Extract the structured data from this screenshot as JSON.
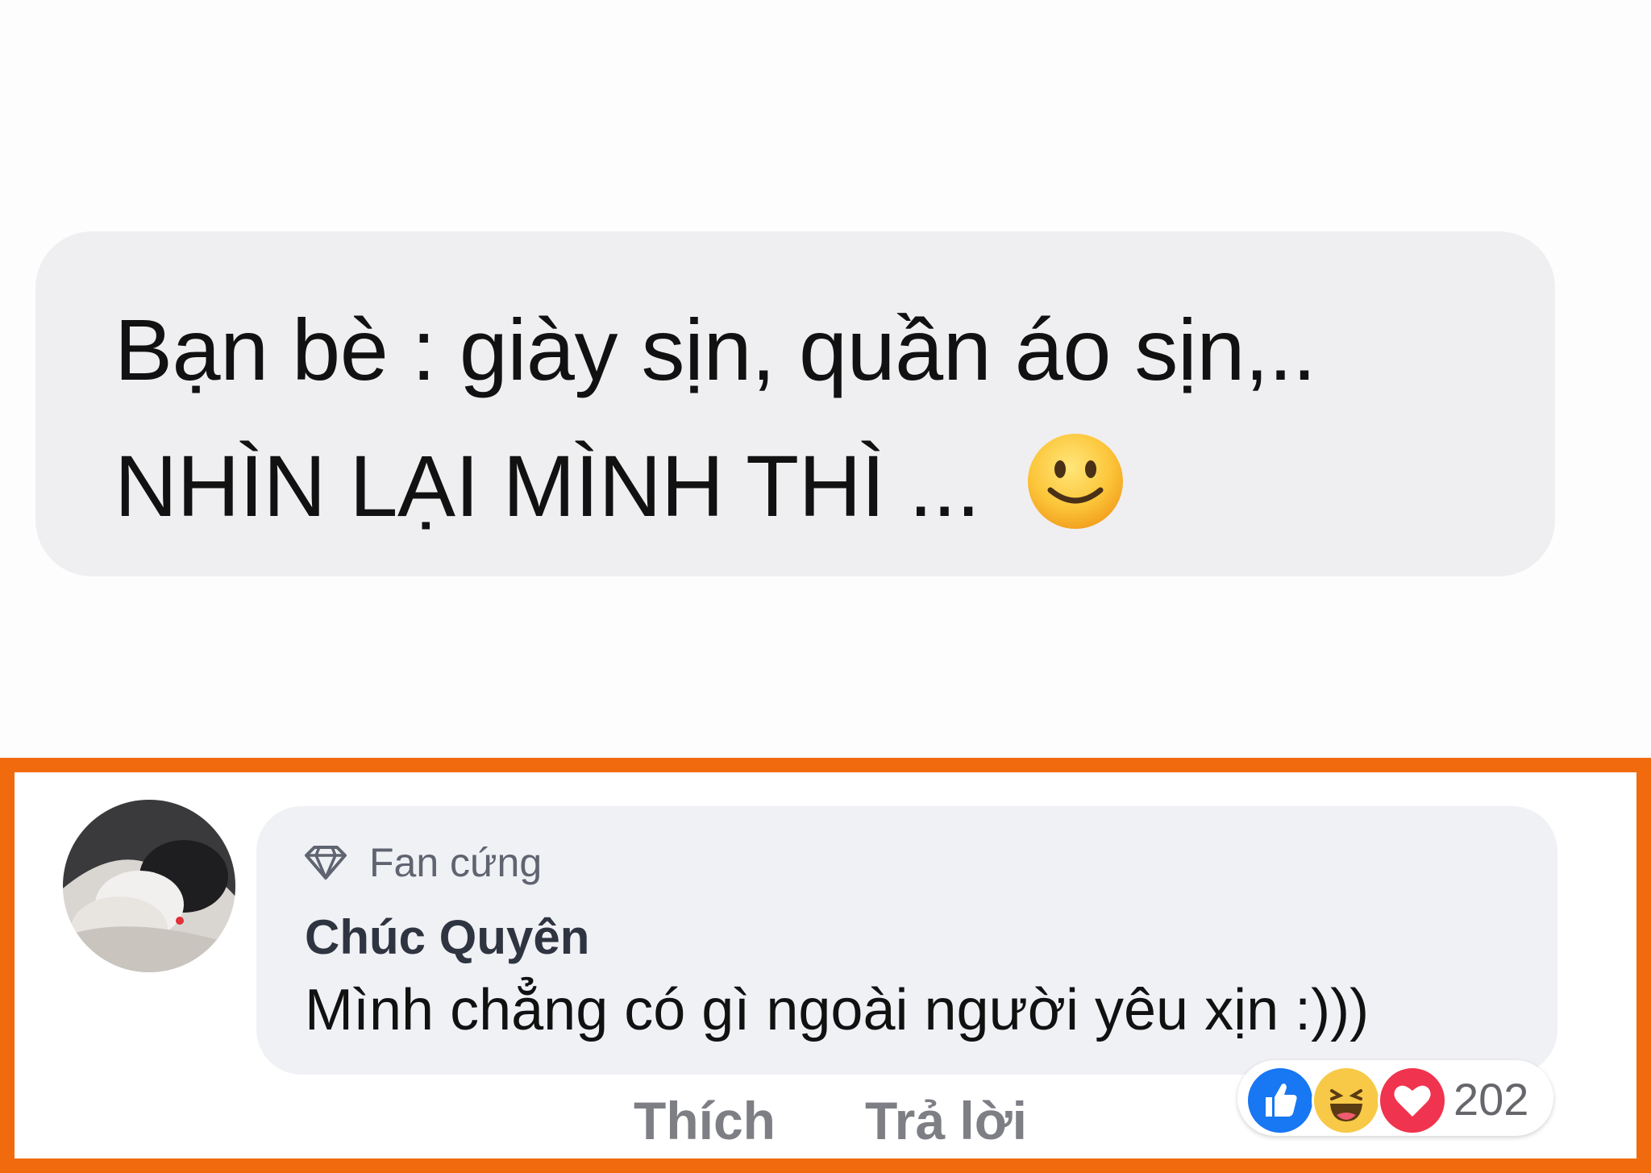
{
  "post": {
    "line1": "Bạn bè : giày sịn, quần áo sịn,..",
    "line2": "NHÌN LẠI MÌNH THÌ ...",
    "emoji": "slightly-smiling-face"
  },
  "comment": {
    "badge_icon": "diamond-icon",
    "badge_label": "Fan cứng",
    "author": "Chúc Quyên",
    "text": "Mình chẳng có gì ngoài người yêu xịn :)))",
    "like_label": "Thích",
    "reply_label": "Trả lời",
    "reactions": [
      "like",
      "haha",
      "love"
    ],
    "reaction_count": "202"
  },
  "colors": {
    "frame": "#f26a0e",
    "post_bubble": "#efeff1",
    "comment_bubble": "#f0f1f5",
    "like": "#1877f2",
    "love": "#f0334e",
    "haha": "#f7c947"
  }
}
